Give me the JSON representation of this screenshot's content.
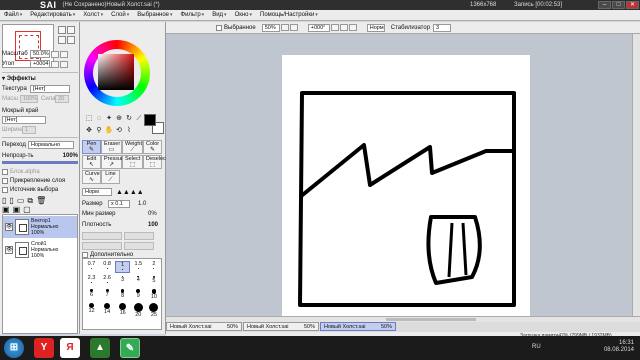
{
  "titlebar": {
    "app_logo": "SAI",
    "title": "(Не Сохранено)Новый Холст.sai (*)",
    "resolution": "1366x768",
    "recording": "Запись [00:02:53]"
  },
  "menu": [
    {
      "label": "Файл"
    },
    {
      "label": "Редактировать"
    },
    {
      "label": "Холст"
    },
    {
      "label": "Слой"
    },
    {
      "label": "Выбранное"
    },
    {
      "label": "Фильтр"
    },
    {
      "label": "Вид"
    },
    {
      "label": "Окно"
    },
    {
      "label": "Помощь/Настройки"
    }
  ],
  "navigator": {
    "zoom_label": "Масштаб",
    "zoom_value": "50.0%",
    "angle_label": "Угол",
    "angle_value": "+0004"
  },
  "effects": {
    "header": "Эффекты",
    "texture_label": "Текстура",
    "texture_value": "[Нет]",
    "texture_scale_label": "Масш",
    "texture_scale_value": "100%",
    "texture_strength_label": "Сила",
    "texture_strength_value": "20",
    "wet_edge_label": "Мокрый край",
    "wet_edge_value": "[Нет]",
    "wet_edge_width_label": "Ширина",
    "wet_edge_width_value": "1"
  },
  "layer_props": {
    "mode_label": "Переход",
    "mode_value": "Нормально",
    "opacity_label": "Непрозр-ть",
    "opacity_value": "100%",
    "protect_alpha": "Блок.alpha",
    "clip_group": "Прикрепление слоя",
    "selection_source": "Источник выбора"
  },
  "layers": [
    {
      "name": "Вектор1",
      "mode": "Нормально",
      "opacity": "100%",
      "selected": true
    },
    {
      "name": "Слой1",
      "mode": "Нормально",
      "opacity": "100%",
      "selected": false
    }
  ],
  "color": {
    "primary": "#000000",
    "secondary": "#ffffff"
  },
  "tool_tabs": [
    {
      "label": "Pen",
      "icon": "pen-icon"
    },
    {
      "label": "Eraser",
      "icon": "eraser-icon"
    },
    {
      "label": "Weight",
      "icon": "weight-icon"
    },
    {
      "label": "Color",
      "icon": "color-icon"
    },
    {
      "label": "Edit",
      "icon": "edit-icon"
    },
    {
      "label": "Pressure",
      "icon": "pressure-icon"
    },
    {
      "label": "Select",
      "icon": "select-icon"
    },
    {
      "label": "Deselect",
      "icon": "deselect-icon"
    },
    {
      "label": "Curve",
      "icon": "curve-icon"
    },
    {
      "label": "Line",
      "icon": "line-icon"
    }
  ],
  "brush": {
    "mode_value": "Норм",
    "size_label": "Размер",
    "size_mult": "x 0.1",
    "size_value": "1.0",
    "min_size_label": "Мин размер",
    "min_size_value": "0%",
    "density_label": "Плотность",
    "density_value": "100",
    "advanced_label": "Дополнительно"
  },
  "brush_sizes": [
    "0.7",
    "0.8",
    "1",
    "1.5",
    "2",
    "2.3",
    "2.6",
    "3",
    "4",
    "5",
    "6",
    "7",
    "8",
    "9",
    "10",
    "12",
    "14",
    "16",
    "20",
    "25"
  ],
  "canvas_toolbar": {
    "selection_label": "Выбранное",
    "zoom_value": "50%",
    "angle_value": "+000°",
    "flip_value": "Норм",
    "stabilizer_label": "Стабилизатор",
    "stabilizer_value": "3"
  },
  "documents": [
    {
      "name": "Новый Холст.sai",
      "zoom": "50%",
      "active": false
    },
    {
      "name": "Новый Холст.sai",
      "zoom": "50%",
      "active": false
    },
    {
      "name": "Новый Холст.sai",
      "zoom": "50%",
      "active": true
    }
  ],
  "status": {
    "memory": "Загрузка памяти42% (799MB / 1932MB)"
  },
  "taskbar": {
    "lang": "RU",
    "time": "16:31",
    "date": "08.08.2014"
  },
  "accent": "#c3cdf0"
}
